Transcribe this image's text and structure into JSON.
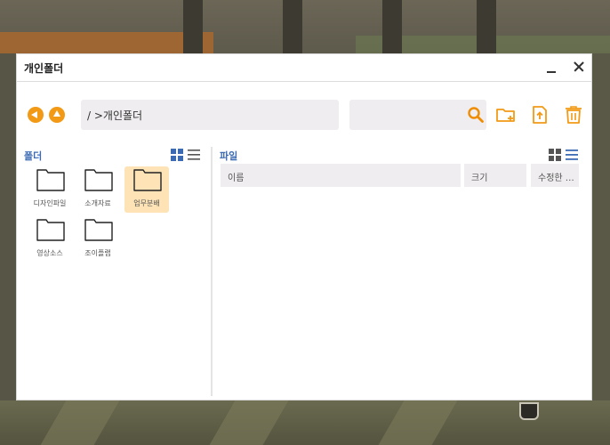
{
  "window": {
    "title": "개인폴더"
  },
  "toolbar": {
    "path": "/ >개인폴더",
    "search": {
      "value": "",
      "placeholder": ""
    },
    "icons": [
      "back-arrow-icon",
      "up-arrow-icon",
      "search-icon",
      "new-folder-icon",
      "upload-icon",
      "trash-icon"
    ]
  },
  "folder_panel": {
    "title": "폴더",
    "folders": [
      {
        "label": "디자인파일",
        "selected": false
      },
      {
        "label": "소개자료",
        "selected": false
      },
      {
        "label": "업무분배",
        "selected": true
      },
      {
        "label": "영상소스",
        "selected": false
      },
      {
        "label": "조이플랩",
        "selected": false
      }
    ]
  },
  "file_panel": {
    "title": "파일",
    "columns": [
      "이름",
      "크기",
      "수정한 …"
    ],
    "rows": []
  },
  "colors": {
    "accent_orange": "#f29a16",
    "heading_blue": "#3d6bb3",
    "selected_folder_bg": "#fde3b6",
    "field_bg": "#efedef"
  }
}
